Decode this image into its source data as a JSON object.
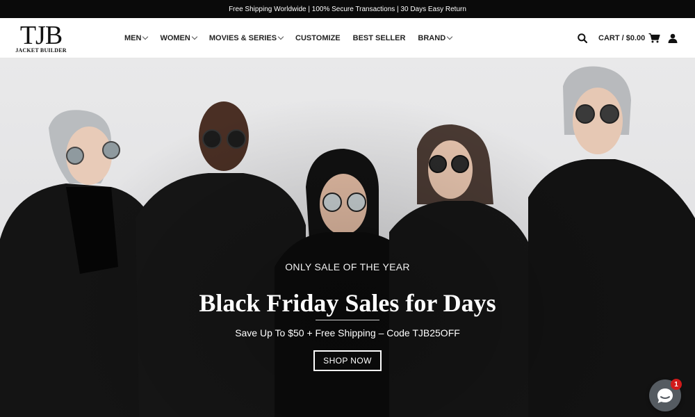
{
  "topbar": {
    "text": "Free Shipping Worldwide | 100% Secure Transactions | 30 Days Easy Return"
  },
  "logo": {
    "main": "TJB",
    "sub": "JACKET BUILDER"
  },
  "nav": {
    "items": [
      {
        "label": "MEN",
        "dropdown": true
      },
      {
        "label": "WOMEN",
        "dropdown": true
      },
      {
        "label": "MOVIES & SERIES",
        "dropdown": true
      },
      {
        "label": "CUSTOMIZE",
        "dropdown": false
      },
      {
        "label": "BEST SELLER",
        "dropdown": false
      },
      {
        "label": "BRAND",
        "dropdown": true
      }
    ]
  },
  "tools": {
    "cart_label": "CART / $0.00",
    "search_icon": "search-icon",
    "cart_icon": "cart-icon",
    "user_icon": "user-icon"
  },
  "hero": {
    "kicker": "ONLY SALE OF THE YEAR",
    "title": "Black Friday Sales for Days",
    "subtitle": "Save Up To $50 + Free Shipping – Code TJB25OFF",
    "button": "SHOP NOW"
  },
  "chat": {
    "badge_count": "1",
    "icon": "chat-icon"
  },
  "colors": {
    "topbar_bg": "#0a0a0a",
    "badge": "#d11a1a",
    "chat_bg": "#555b61"
  }
}
